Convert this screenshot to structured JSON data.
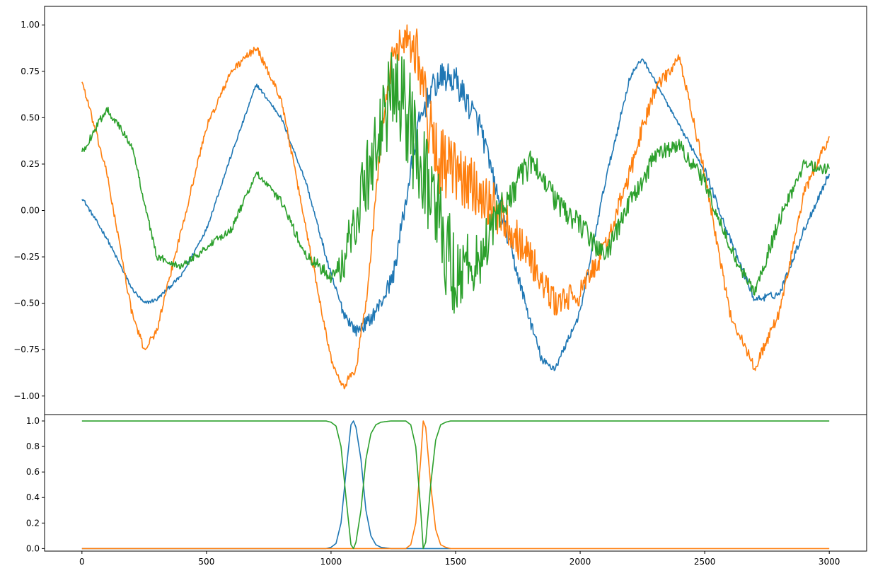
{
  "chart_data": [
    {
      "type": "line",
      "title": "",
      "xlabel": "",
      "ylabel": "",
      "xlim": [
        -150,
        3150
      ],
      "ylim": [
        -1.1,
        1.1
      ],
      "yticks": [
        -1.0,
        -0.75,
        -0.5,
        -0.25,
        0.0,
        0.25,
        0.5,
        0.75,
        1.0
      ],
      "ytick_labels": [
        "−1.00",
        "−0.75",
        "−0.50",
        "−0.25",
        "0.00",
        "0.25",
        "0.50",
        "0.75",
        "1.00"
      ],
      "grid": false,
      "x": [
        0,
        100,
        200,
        250,
        300,
        400,
        500,
        600,
        700,
        800,
        900,
        1000,
        1050,
        1100,
        1150,
        1200,
        1250,
        1300,
        1350,
        1400,
        1450,
        1500,
        1600,
        1700,
        1800,
        1850,
        1900,
        2000,
        2100,
        2200,
        2250,
        2300,
        2400,
        2500,
        2600,
        2700,
        2800,
        2900,
        3000
      ],
      "series": [
        {
          "color": "#1f77b4",
          "noise": [
            0.01,
            0.01,
            0.01,
            0.01,
            0.01,
            0.01,
            0.01,
            0.01,
            0.01,
            0.01,
            0.01,
            0.02,
            0.03,
            0.03,
            0.04,
            0.04,
            0.05,
            0.06,
            0.07,
            0.07,
            0.08,
            0.08,
            0.07,
            0.05,
            0.03,
            0.03,
            0.02,
            0.02,
            0.02,
            0.02,
            0.01,
            0.01,
            0.01,
            0.02,
            0.02,
            0.02,
            0.02,
            0.02,
            0.02
          ],
          "values": [
            0.07,
            -0.15,
            -0.42,
            -0.5,
            -0.48,
            -0.35,
            -0.1,
            0.3,
            0.68,
            0.5,
            0.15,
            -0.35,
            -0.55,
            -0.65,
            -0.6,
            -0.5,
            -0.35,
            0.05,
            0.45,
            0.65,
            0.72,
            0.7,
            0.45,
            -0.1,
            -0.6,
            -0.82,
            -0.85,
            -0.55,
            0.15,
            0.72,
            0.82,
            0.7,
            0.45,
            0.22,
            -0.15,
            -0.48,
            -0.45,
            -0.1,
            0.2
          ]
        },
        {
          "color": "#ff7f0e",
          "noise": [
            0.02,
            0.02,
            0.02,
            0.02,
            0.02,
            0.02,
            0.02,
            0.02,
            0.02,
            0.02,
            0.02,
            0.02,
            0.02,
            0.03,
            0.04,
            0.05,
            0.08,
            0.1,
            0.15,
            0.2,
            0.2,
            0.17,
            0.14,
            0.12,
            0.1,
            0.08,
            0.08,
            0.07,
            0.06,
            0.05,
            0.05,
            0.04,
            0.03,
            0.03,
            0.03,
            0.03,
            0.03,
            0.03,
            0.03
          ],
          "values": [
            0.7,
            0.2,
            -0.55,
            -0.75,
            -0.65,
            -0.1,
            0.45,
            0.75,
            0.88,
            0.6,
            -0.1,
            -0.8,
            -0.95,
            -0.85,
            -0.4,
            0.4,
            0.85,
            0.95,
            0.85,
            0.4,
            0.25,
            0.2,
            0.1,
            -0.05,
            -0.25,
            -0.4,
            -0.5,
            -0.45,
            -0.2,
            0.2,
            0.45,
            0.65,
            0.82,
            0.2,
            -0.55,
            -0.85,
            -0.55,
            0.1,
            0.4
          ]
        },
        {
          "color": "#2ca02c",
          "noise": [
            0.02,
            0.02,
            0.02,
            0.02,
            0.02,
            0.02,
            0.02,
            0.02,
            0.02,
            0.02,
            0.03,
            0.04,
            0.1,
            0.2,
            0.2,
            0.22,
            0.25,
            0.3,
            0.3,
            0.3,
            0.3,
            0.25,
            0.15,
            0.1,
            0.08,
            0.07,
            0.06,
            0.06,
            0.06,
            0.05,
            0.05,
            0.05,
            0.04,
            0.04,
            0.04,
            0.04,
            0.04,
            0.03,
            0.03
          ],
          "values": [
            0.31,
            0.55,
            0.35,
            0.05,
            -0.25,
            -0.3,
            -0.2,
            -0.1,
            0.2,
            0.05,
            -0.25,
            -0.35,
            -0.3,
            0.0,
            0.2,
            0.45,
            0.65,
            0.5,
            0.35,
            0.1,
            -0.15,
            -0.35,
            -0.25,
            0.05,
            0.25,
            0.2,
            0.05,
            -0.08,
            -0.25,
            0.05,
            0.15,
            0.3,
            0.35,
            0.15,
            -0.2,
            -0.45,
            -0.05,
            0.25,
            0.22
          ]
        }
      ]
    },
    {
      "type": "line",
      "title": "",
      "xlabel": "",
      "ylabel": "",
      "xlim": [
        -150,
        3150
      ],
      "ylim": [
        -0.02,
        1.05
      ],
      "yticks": [
        0.0,
        0.2,
        0.4,
        0.6,
        0.8,
        1.0
      ],
      "ytick_labels": [
        "0.0",
        "0.2",
        "0.4",
        "0.6",
        "0.8",
        "1.0"
      ],
      "xticks": [
        0,
        500,
        1000,
        1500,
        2000,
        2500,
        3000
      ],
      "xtick_labels": [
        "0",
        "500",
        "1000",
        "1500",
        "2000",
        "2500",
        "3000"
      ],
      "grid": false,
      "x": [
        0,
        980,
        1000,
        1020,
        1040,
        1060,
        1080,
        1090,
        1100,
        1120,
        1140,
        1160,
        1180,
        1200,
        1240,
        1300,
        1320,
        1340,
        1360,
        1370,
        1380,
        1400,
        1420,
        1440,
        1460,
        1480,
        1500,
        3000
      ],
      "series": [
        {
          "color": "#1f77b4",
          "values": [
            0,
            0,
            0.01,
            0.04,
            0.2,
            0.6,
            0.97,
            1.0,
            0.95,
            0.7,
            0.3,
            0.1,
            0.03,
            0.01,
            0,
            0,
            0,
            0,
            0,
            0,
            0,
            0,
            0,
            0,
            0,
            0,
            0,
            0
          ],
          "end_x": 1480
        },
        {
          "color": "#ff7f0e",
          "values": [
            0,
            0,
            0,
            0,
            0,
            0,
            0,
            0,
            0,
            0,
            0,
            0,
            0,
            0,
            0,
            0,
            0.03,
            0.2,
            0.7,
            1.0,
            0.95,
            0.5,
            0.15,
            0.03,
            0.01,
            0,
            0,
            0
          ]
        },
        {
          "color": "#2ca02c",
          "values": [
            1,
            1,
            0.99,
            0.96,
            0.8,
            0.4,
            0.03,
            0.0,
            0.05,
            0.3,
            0.7,
            0.9,
            0.97,
            0.99,
            1,
            1,
            0.97,
            0.8,
            0.3,
            0.0,
            0.05,
            0.5,
            0.85,
            0.97,
            0.99,
            1,
            1,
            1
          ]
        }
      ]
    }
  ]
}
